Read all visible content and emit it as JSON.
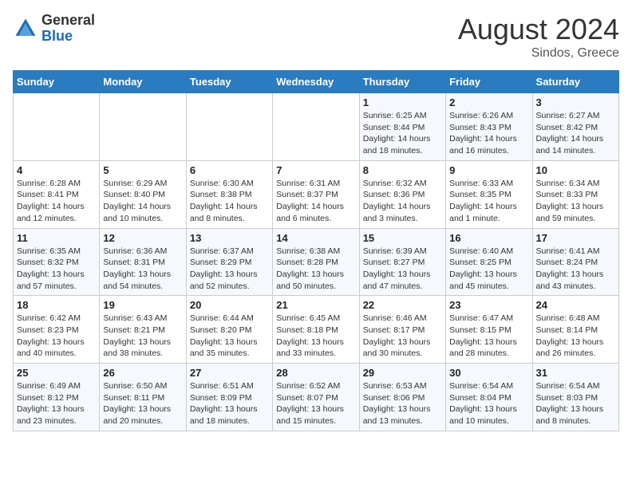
{
  "logo": {
    "general": "General",
    "blue": "Blue"
  },
  "title": "August 2024",
  "subtitle": "Sindos, Greece",
  "days_of_week": [
    "Sunday",
    "Monday",
    "Tuesday",
    "Wednesday",
    "Thursday",
    "Friday",
    "Saturday"
  ],
  "weeks": [
    [
      {
        "day": "",
        "info": ""
      },
      {
        "day": "",
        "info": ""
      },
      {
        "day": "",
        "info": ""
      },
      {
        "day": "",
        "info": ""
      },
      {
        "day": "1",
        "info": "Sunrise: 6:25 AM\nSunset: 8:44 PM\nDaylight: 14 hours\nand 18 minutes."
      },
      {
        "day": "2",
        "info": "Sunrise: 6:26 AM\nSunset: 8:43 PM\nDaylight: 14 hours\nand 16 minutes."
      },
      {
        "day": "3",
        "info": "Sunrise: 6:27 AM\nSunset: 8:42 PM\nDaylight: 14 hours\nand 14 minutes."
      }
    ],
    [
      {
        "day": "4",
        "info": "Sunrise: 6:28 AM\nSunset: 8:41 PM\nDaylight: 14 hours\nand 12 minutes."
      },
      {
        "day": "5",
        "info": "Sunrise: 6:29 AM\nSunset: 8:40 PM\nDaylight: 14 hours\nand 10 minutes."
      },
      {
        "day": "6",
        "info": "Sunrise: 6:30 AM\nSunset: 8:38 PM\nDaylight: 14 hours\nand 8 minutes."
      },
      {
        "day": "7",
        "info": "Sunrise: 6:31 AM\nSunset: 8:37 PM\nDaylight: 14 hours\nand 6 minutes."
      },
      {
        "day": "8",
        "info": "Sunrise: 6:32 AM\nSunset: 8:36 PM\nDaylight: 14 hours\nand 3 minutes."
      },
      {
        "day": "9",
        "info": "Sunrise: 6:33 AM\nSunset: 8:35 PM\nDaylight: 14 hours\nand 1 minute."
      },
      {
        "day": "10",
        "info": "Sunrise: 6:34 AM\nSunset: 8:33 PM\nDaylight: 13 hours\nand 59 minutes."
      }
    ],
    [
      {
        "day": "11",
        "info": "Sunrise: 6:35 AM\nSunset: 8:32 PM\nDaylight: 13 hours\nand 57 minutes."
      },
      {
        "day": "12",
        "info": "Sunrise: 6:36 AM\nSunset: 8:31 PM\nDaylight: 13 hours\nand 54 minutes."
      },
      {
        "day": "13",
        "info": "Sunrise: 6:37 AM\nSunset: 8:29 PM\nDaylight: 13 hours\nand 52 minutes."
      },
      {
        "day": "14",
        "info": "Sunrise: 6:38 AM\nSunset: 8:28 PM\nDaylight: 13 hours\nand 50 minutes."
      },
      {
        "day": "15",
        "info": "Sunrise: 6:39 AM\nSunset: 8:27 PM\nDaylight: 13 hours\nand 47 minutes."
      },
      {
        "day": "16",
        "info": "Sunrise: 6:40 AM\nSunset: 8:25 PM\nDaylight: 13 hours\nand 45 minutes."
      },
      {
        "day": "17",
        "info": "Sunrise: 6:41 AM\nSunset: 8:24 PM\nDaylight: 13 hours\nand 43 minutes."
      }
    ],
    [
      {
        "day": "18",
        "info": "Sunrise: 6:42 AM\nSunset: 8:23 PM\nDaylight: 13 hours\nand 40 minutes."
      },
      {
        "day": "19",
        "info": "Sunrise: 6:43 AM\nSunset: 8:21 PM\nDaylight: 13 hours\nand 38 minutes."
      },
      {
        "day": "20",
        "info": "Sunrise: 6:44 AM\nSunset: 8:20 PM\nDaylight: 13 hours\nand 35 minutes."
      },
      {
        "day": "21",
        "info": "Sunrise: 6:45 AM\nSunset: 8:18 PM\nDaylight: 13 hours\nand 33 minutes."
      },
      {
        "day": "22",
        "info": "Sunrise: 6:46 AM\nSunset: 8:17 PM\nDaylight: 13 hours\nand 30 minutes."
      },
      {
        "day": "23",
        "info": "Sunrise: 6:47 AM\nSunset: 8:15 PM\nDaylight: 13 hours\nand 28 minutes."
      },
      {
        "day": "24",
        "info": "Sunrise: 6:48 AM\nSunset: 8:14 PM\nDaylight: 13 hours\nand 26 minutes."
      }
    ],
    [
      {
        "day": "25",
        "info": "Sunrise: 6:49 AM\nSunset: 8:12 PM\nDaylight: 13 hours\nand 23 minutes."
      },
      {
        "day": "26",
        "info": "Sunrise: 6:50 AM\nSunset: 8:11 PM\nDaylight: 13 hours\nand 20 minutes."
      },
      {
        "day": "27",
        "info": "Sunrise: 6:51 AM\nSunset: 8:09 PM\nDaylight: 13 hours\nand 18 minutes."
      },
      {
        "day": "28",
        "info": "Sunrise: 6:52 AM\nSunset: 8:07 PM\nDaylight: 13 hours\nand 15 minutes."
      },
      {
        "day": "29",
        "info": "Sunrise: 6:53 AM\nSunset: 8:06 PM\nDaylight: 13 hours\nand 13 minutes."
      },
      {
        "day": "30",
        "info": "Sunrise: 6:54 AM\nSunset: 8:04 PM\nDaylight: 13 hours\nand 10 minutes."
      },
      {
        "day": "31",
        "info": "Sunrise: 6:54 AM\nSunset: 8:03 PM\nDaylight: 13 hours\nand 8 minutes."
      }
    ]
  ]
}
